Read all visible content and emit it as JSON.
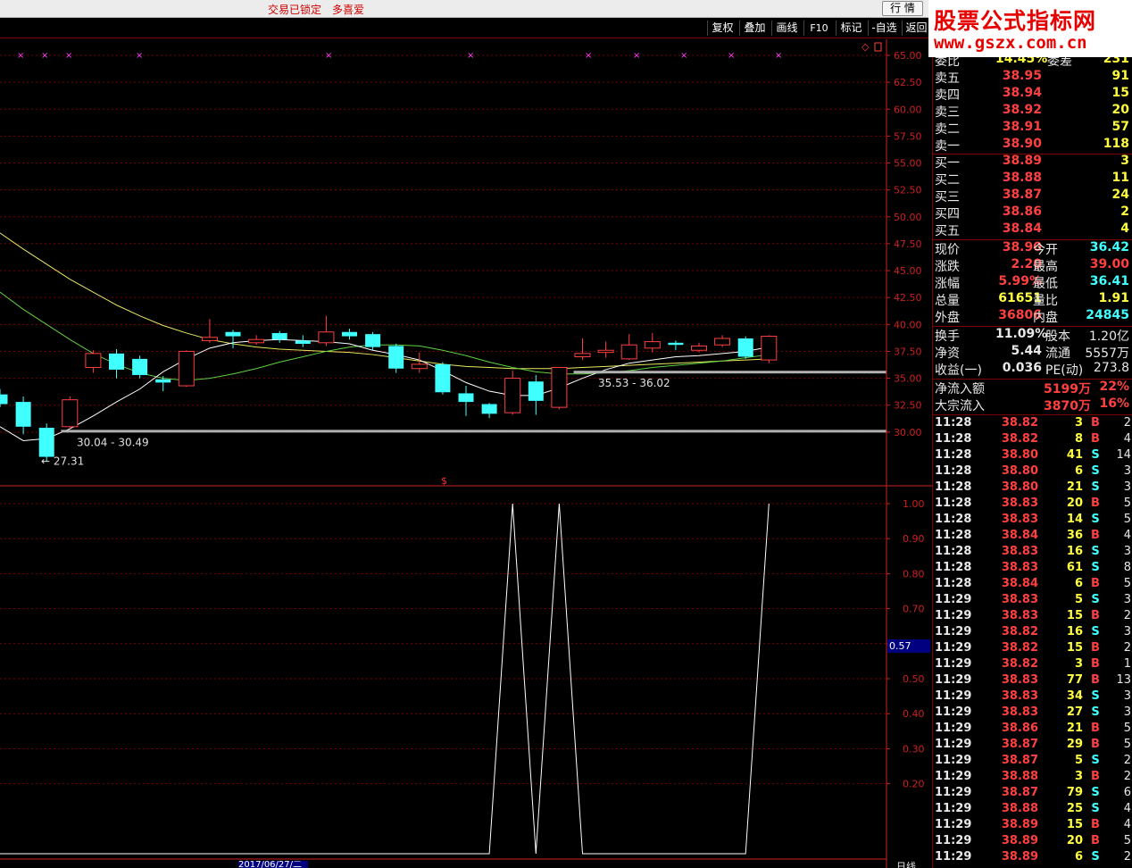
{
  "topbar": {
    "lock_label": "交易已锁定",
    "fav_label": "多喜爱",
    "market_button": "行 情"
  },
  "toolbar": {
    "fuquan": "复权",
    "diejia": "叠加",
    "huaxian": "画线",
    "f10": "F10",
    "biaoji": "标记",
    "zixuan": "-自选",
    "fanhui": "返回"
  },
  "logo": {
    "line1": "股票公式指标网",
    "line2": "www.gszx.com.cn"
  },
  "quote": {
    "header_partial": {
      "label": "委比",
      "value": "14.45%",
      "label2": "委差",
      "value2": "231"
    },
    "sell": [
      {
        "label": "卖五",
        "price": "38.95",
        "vol": "91"
      },
      {
        "label": "卖四",
        "price": "38.94",
        "vol": "15"
      },
      {
        "label": "卖三",
        "price": "38.92",
        "vol": "20"
      },
      {
        "label": "卖二",
        "price": "38.91",
        "vol": "57"
      },
      {
        "label": "卖一",
        "price": "38.90",
        "vol": "118"
      }
    ],
    "buy": [
      {
        "label": "买一",
        "price": "38.89",
        "vol": "3"
      },
      {
        "label": "买二",
        "price": "38.88",
        "vol": "11"
      },
      {
        "label": "买三",
        "price": "38.87",
        "vol": "24"
      },
      {
        "label": "买四",
        "price": "38.86",
        "vol": "2"
      },
      {
        "label": "买五",
        "price": "38.84",
        "vol": "4"
      }
    ],
    "stats": [
      {
        "l1": "现价",
        "v1": "38.90",
        "c1": "red",
        "l2": "今开",
        "v2": "36.42",
        "c2": "cyan"
      },
      {
        "l1": "涨跌",
        "v1": "2.20",
        "c1": "red",
        "l2": "最高",
        "v2": "39.00",
        "c2": "red"
      },
      {
        "l1": "涨幅",
        "v1": "5.99%",
        "c1": "red",
        "l2": "最低",
        "v2": "36.41",
        "c2": "cyan"
      },
      {
        "l1": "总量",
        "v1": "61651",
        "c1": "yellow",
        "l2": "量比",
        "v2": "1.91",
        "c2": "yellow"
      },
      {
        "l1": "外盘",
        "v1": "36806",
        "c1": "red",
        "l2": "内盘",
        "v2": "24845",
        "c2": "cyan"
      }
    ],
    "stats2": [
      {
        "l1": "换手",
        "v1": "11.09%",
        "l2": "股本",
        "v2": "1.20亿"
      },
      {
        "l1": "净资",
        "v1": "5.44",
        "l2": "流通",
        "v2": "5557万"
      },
      {
        "l1": "收益(一)",
        "v1": "0.036",
        "l2": "PE(动)",
        "v2": "273.8"
      }
    ],
    "flow": [
      {
        "label": "净流入额",
        "value": "5199万",
        "pct": "22%"
      },
      {
        "label": "大宗流入",
        "value": "3870万",
        "pct": "16%"
      }
    ],
    "ticks": [
      {
        "time": "11:28",
        "price": "38.82",
        "vol": "3",
        "bs": "B",
        "cnt": "2"
      },
      {
        "time": "11:28",
        "price": "38.82",
        "vol": "8",
        "bs": "B",
        "cnt": "4"
      },
      {
        "time": "11:28",
        "price": "38.80",
        "vol": "41",
        "bs": "S",
        "cnt": "14"
      },
      {
        "time": "11:28",
        "price": "38.80",
        "vol": "6",
        "bs": "S",
        "cnt": "3"
      },
      {
        "time": "11:28",
        "price": "38.80",
        "vol": "21",
        "bs": "S",
        "cnt": "3"
      },
      {
        "time": "11:28",
        "price": "38.83",
        "vol": "20",
        "bs": "B",
        "cnt": "5"
      },
      {
        "time": "11:28",
        "price": "38.83",
        "vol": "14",
        "bs": "S",
        "cnt": "5"
      },
      {
        "time": "11:28",
        "price": "38.84",
        "vol": "36",
        "bs": "B",
        "cnt": "4"
      },
      {
        "time": "11:28",
        "price": "38.83",
        "vol": "16",
        "bs": "S",
        "cnt": "3"
      },
      {
        "time": "11:28",
        "price": "38.83",
        "vol": "61",
        "bs": "S",
        "cnt": "8"
      },
      {
        "time": "11:28",
        "price": "38.84",
        "vol": "6",
        "bs": "B",
        "cnt": "5"
      },
      {
        "time": "11:29",
        "price": "38.83",
        "vol": "5",
        "bs": "S",
        "cnt": "3"
      },
      {
        "time": "11:29",
        "price": "38.83",
        "vol": "15",
        "bs": "B",
        "cnt": "2"
      },
      {
        "time": "11:29",
        "price": "38.82",
        "vol": "16",
        "bs": "S",
        "cnt": "3"
      },
      {
        "time": "11:29",
        "price": "38.82",
        "vol": "15",
        "bs": "B",
        "cnt": "2"
      },
      {
        "time": "11:29",
        "price": "38.82",
        "vol": "3",
        "bs": "B",
        "cnt": "1"
      },
      {
        "time": "11:29",
        "price": "38.83",
        "vol": "77",
        "bs": "B",
        "cnt": "13"
      },
      {
        "time": "11:29",
        "price": "38.83",
        "vol": "34",
        "bs": "S",
        "cnt": "3"
      },
      {
        "time": "11:29",
        "price": "38.83",
        "vol": "27",
        "bs": "S",
        "cnt": "3"
      },
      {
        "time": "11:29",
        "price": "38.86",
        "vol": "21",
        "bs": "B",
        "cnt": "5"
      },
      {
        "time": "11:29",
        "price": "38.87",
        "vol": "29",
        "bs": "B",
        "cnt": "5"
      },
      {
        "time": "11:29",
        "price": "38.87",
        "vol": "5",
        "bs": "S",
        "cnt": "2"
      },
      {
        "time": "11:29",
        "price": "38.88",
        "vol": "3",
        "bs": "B",
        "cnt": "2"
      },
      {
        "time": "11:29",
        "price": "38.87",
        "vol": "79",
        "bs": "S",
        "cnt": "6"
      },
      {
        "time": "11:29",
        "price": "38.88",
        "vol": "25",
        "bs": "S",
        "cnt": "4"
      },
      {
        "time": "11:29",
        "price": "38.89",
        "vol": "15",
        "bs": "B",
        "cnt": "4"
      },
      {
        "time": "11:29",
        "price": "38.89",
        "vol": "20",
        "bs": "B",
        "cnt": "5"
      },
      {
        "time": "11:29",
        "price": "38.89",
        "vol": "6",
        "bs": "S",
        "cnt": "2"
      }
    ]
  },
  "bottom": {
    "day_label": "日线",
    "date_label": "2017/06/27/二",
    "current_value": "0.57",
    "mid_marker": "$"
  },
  "chart_data": [
    {
      "type": "candlestick",
      "ylim": [
        27.0,
        65.0
      ],
      "yticks": [
        "30.00",
        "32.50",
        "35.00",
        "37.50",
        "40.00",
        "42.50",
        "45.00",
        "47.50",
        "50.00",
        "52.50",
        "55.00",
        "57.50",
        "60.00",
        "62.50",
        "65.00"
      ],
      "candles": [
        {
          "o": 33.5,
          "h": 34.0,
          "l": 32.3,
          "c": 32.6
        },
        {
          "o": 32.8,
          "h": 33.3,
          "l": 29.8,
          "c": 30.5
        },
        {
          "o": 30.4,
          "h": 30.8,
          "l": 27.3,
          "c": 27.7
        },
        {
          "o": 30.5,
          "h": 33.3,
          "l": 30.3,
          "c": 33.0
        },
        {
          "o": 36.0,
          "h": 37.6,
          "l": 35.5,
          "c": 37.3
        },
        {
          "o": 37.3,
          "h": 37.7,
          "l": 35.0,
          "c": 35.8
        },
        {
          "o": 36.8,
          "h": 37.1,
          "l": 35.0,
          "c": 35.3
        },
        {
          "o": 34.9,
          "h": 35.2,
          "l": 33.8,
          "c": 34.6
        },
        {
          "o": 34.3,
          "h": 37.6,
          "l": 34.2,
          "c": 37.5
        },
        {
          "o": 38.5,
          "h": 40.5,
          "l": 38.3,
          "c": 38.8
        },
        {
          "o": 39.3,
          "h": 39.5,
          "l": 37.8,
          "c": 38.9
        },
        {
          "o": 38.3,
          "h": 39.0,
          "l": 38.1,
          "c": 38.6
        },
        {
          "o": 39.2,
          "h": 39.4,
          "l": 38.3,
          "c": 38.6
        },
        {
          "o": 38.5,
          "h": 39.0,
          "l": 37.9,
          "c": 38.2
        },
        {
          "o": 38.3,
          "h": 40.8,
          "l": 38.0,
          "c": 39.3
        },
        {
          "o": 39.3,
          "h": 39.6,
          "l": 38.6,
          "c": 38.9
        },
        {
          "o": 39.1,
          "h": 39.3,
          "l": 37.6,
          "c": 37.9
        },
        {
          "o": 38.0,
          "h": 38.2,
          "l": 35.5,
          "c": 35.9
        },
        {
          "o": 35.9,
          "h": 37.4,
          "l": 35.5,
          "c": 36.3
        },
        {
          "o": 36.3,
          "h": 36.5,
          "l": 33.5,
          "c": 33.7
        },
        {
          "o": 33.6,
          "h": 34.3,
          "l": 31.5,
          "c": 32.8
        },
        {
          "o": 32.6,
          "h": 32.7,
          "l": 31.3,
          "c": 31.7
        },
        {
          "o": 31.8,
          "h": 35.7,
          "l": 31.6,
          "c": 35.0
        },
        {
          "o": 34.7,
          "h": 35.3,
          "l": 31.6,
          "c": 32.9
        },
        {
          "o": 32.3,
          "h": 35.4,
          "l": 32.1,
          "c": 36.0
        },
        {
          "o": 37.0,
          "h": 38.7,
          "l": 36.7,
          "c": 37.3
        },
        {
          "o": 37.4,
          "h": 38.4,
          "l": 36.9,
          "c": 37.6
        },
        {
          "o": 36.8,
          "h": 39.1,
          "l": 36.7,
          "c": 38.1
        },
        {
          "o": 37.8,
          "h": 39.2,
          "l": 37.4,
          "c": 38.4
        },
        {
          "o": 38.3,
          "h": 38.5,
          "l": 37.6,
          "c": 38.1
        },
        {
          "o": 37.6,
          "h": 38.3,
          "l": 37.4,
          "c": 38.0
        },
        {
          "o": 38.1,
          "h": 39.0,
          "l": 37.9,
          "c": 38.7
        },
        {
          "o": 38.7,
          "h": 38.9,
          "l": 36.8,
          "c": 37.0
        },
        {
          "o": 36.7,
          "h": 39.0,
          "l": 36.4,
          "c": 38.9
        }
      ],
      "ma_short": [
        30.5,
        29.2,
        29.4,
        30.3,
        31.5,
        32.8,
        34.0,
        35.6,
        36.8,
        37.8,
        38.3,
        38.5,
        38.6,
        38.5,
        38.4,
        38.2,
        37.6,
        37.2,
        36.7,
        35.7,
        34.6,
        33.8,
        33.4,
        33.4,
        34.1,
        35.0,
        35.8,
        36.4,
        36.7,
        37.0,
        37.1,
        37.3,
        37.5,
        37.9
      ],
      "ma_mid": [
        43.0,
        41.4,
        40.0,
        38.6,
        37.3,
        36.3,
        35.5,
        35.0,
        34.8,
        35.0,
        35.4,
        35.9,
        36.5,
        37.0,
        37.5,
        37.9,
        38.1,
        38.1,
        38.0,
        37.6,
        37.1,
        36.5,
        36.0,
        35.6,
        35.4,
        35.4,
        35.5,
        35.7,
        36.0,
        36.2,
        36.4,
        36.6,
        36.9,
        37.2
      ],
      "ma_long": [
        48.5,
        47.0,
        45.6,
        44.2,
        43.0,
        41.8,
        40.8,
        39.9,
        39.2,
        38.6,
        38.2,
        37.9,
        37.7,
        37.6,
        37.5,
        37.4,
        37.2,
        36.9,
        36.6,
        36.3,
        36.1,
        36.0,
        35.9,
        35.9,
        35.9,
        36.0,
        36.1,
        36.2,
        36.3,
        36.4,
        36.5,
        36.6,
        36.7,
        36.8
      ],
      "annotations": [
        {
          "text": "30.04 - 30.49",
          "price": 30.04
        },
        {
          "text": "35.53 - 36.02",
          "price": 35.53
        },
        {
          "text": "27.31",
          "price": 27.31
        }
      ],
      "support_lines": [
        30.04,
        35.53
      ]
    },
    {
      "type": "line",
      "ylim": [
        0.0,
        1.0
      ],
      "yticks": [
        "0.20",
        "0.30",
        "0.40",
        "0.50",
        "0.60",
        "0.70",
        "0.80",
        "0.90",
        "1.00"
      ],
      "values": [
        0,
        0,
        0,
        0,
        0,
        0,
        0,
        0,
        0,
        0,
        0,
        0,
        0,
        0,
        0,
        0,
        0,
        0,
        0,
        0,
        0,
        0,
        1,
        0,
        1,
        0,
        0,
        0,
        0,
        0,
        0,
        0,
        0,
        1
      ]
    }
  ]
}
